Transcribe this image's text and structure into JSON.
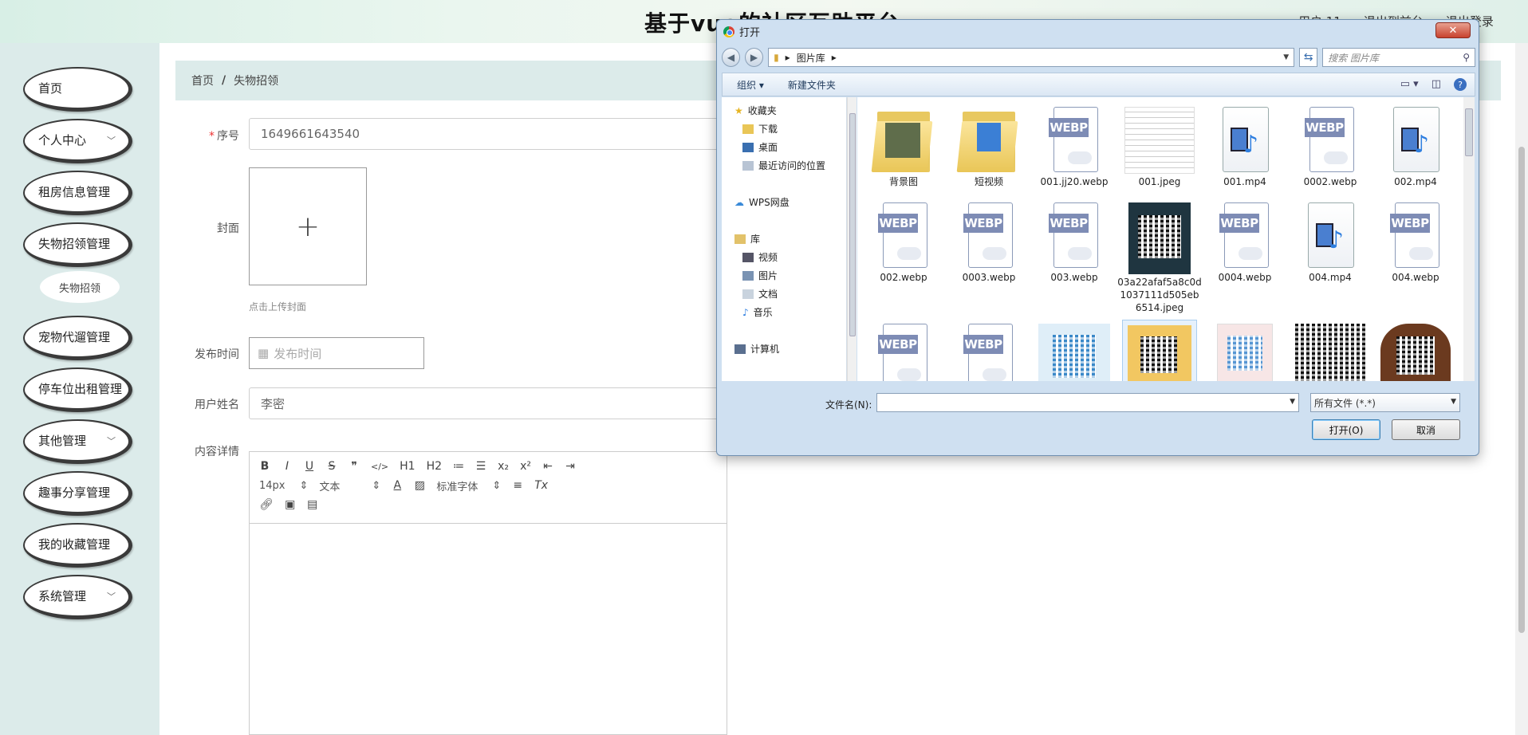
{
  "header": {
    "site_title": "基于vue的社区互助平台",
    "user_label": "用户 11",
    "exit_link": "退出到前台",
    "logout_link": "退出登录"
  },
  "sidebar": {
    "items": [
      {
        "label": "首页",
        "has_chevron": false
      },
      {
        "label": "个人中心",
        "has_chevron": true
      },
      {
        "label": "租房信息管理",
        "has_chevron": false
      },
      {
        "label": "失物招领管理",
        "has_chevron": false
      },
      {
        "label": "宠物代遛管理",
        "has_chevron": false
      },
      {
        "label": "停车位出租管理",
        "has_chevron": false
      },
      {
        "label": "其他管理",
        "has_chevron": true
      },
      {
        "label": "趣事分享管理",
        "has_chevron": false
      },
      {
        "label": "我的收藏管理",
        "has_chevron": false
      },
      {
        "label": "系统管理",
        "has_chevron": true
      }
    ],
    "sub_item": "失物招领"
  },
  "breadcrumb": {
    "home": "首页",
    "separator": "/",
    "current": "失物招领"
  },
  "form": {
    "serial_label": "序号",
    "serial_value": "1649661643540",
    "cover_label": "封面",
    "upload_plus": "+",
    "upload_hint": "点击上传封面",
    "publish_time_label": "发布时间",
    "publish_time_placeholder": "发布时间",
    "username_label": "用户姓名",
    "username_value": "李密",
    "content_label": "内容详情"
  },
  "editor": {
    "row1": [
      "B",
      "I",
      "U",
      "S",
      "❞",
      "</>",
      "H1",
      "H2",
      "≔",
      "☰",
      "x₂",
      "x²",
      "⇤",
      "⇥"
    ],
    "size": "14px",
    "text_style": "文本",
    "font": "标准字体"
  },
  "dialog": {
    "title": "打开",
    "close": "✕",
    "breadcrumb": "图片库",
    "search_placeholder": "搜索 图片库",
    "organize": "组织 ▾",
    "new_folder": "新建文件夹",
    "help": "?",
    "nav": {
      "favorites": "收藏夹",
      "downloads": "下载",
      "desktop": "桌面",
      "recent": "最近访问的位置",
      "wps": "WPS网盘",
      "libraries": "库",
      "videos": "视频",
      "pictures": "图片",
      "documents": "文档",
      "music": "音乐",
      "computer": "计算机"
    },
    "files": [
      {
        "name": "背景图",
        "kind": "folder"
      },
      {
        "name": "短视频",
        "kind": "folder"
      },
      {
        "name": "001.jj20.webp",
        "kind": "webp"
      },
      {
        "name": "001.jpeg",
        "kind": "doc"
      },
      {
        "name": "001.mp4",
        "kind": "video"
      },
      {
        "name": "0002.webp",
        "kind": "webp"
      },
      {
        "name": "002.mp4",
        "kind": "video"
      },
      {
        "name": "002.webp",
        "kind": "webp"
      },
      {
        "name": "0003.webp",
        "kind": "webp"
      },
      {
        "name": "003.webp",
        "kind": "webp"
      },
      {
        "name": "03a22afaf5a8c0d1037111d505eb6514.jpeg",
        "kind": "qr-dark"
      },
      {
        "name": "0004.webp",
        "kind": "webp"
      },
      {
        "name": "004.mp4",
        "kind": "video"
      },
      {
        "name": "004.webp",
        "kind": "webp"
      },
      {
        "name": "",
        "kind": "webp"
      },
      {
        "name": "",
        "kind": "webp"
      },
      {
        "name": "",
        "kind": "qr-blue"
      },
      {
        "name": "",
        "kind": "qr-yellow"
      },
      {
        "name": "",
        "kind": "qr-pink"
      },
      {
        "name": "",
        "kind": "qr-plain"
      },
      {
        "name": "",
        "kind": "qr-brown"
      }
    ],
    "filename_label": "文件名(N):",
    "filetype": "所有文件 (*.*)",
    "open_button": "打开(O)",
    "cancel_button": "取消"
  },
  "colors": {
    "sidebar_bg": "#dcebea",
    "breadcrumb_bg": "#dcebea",
    "required": "#ee3333"
  }
}
